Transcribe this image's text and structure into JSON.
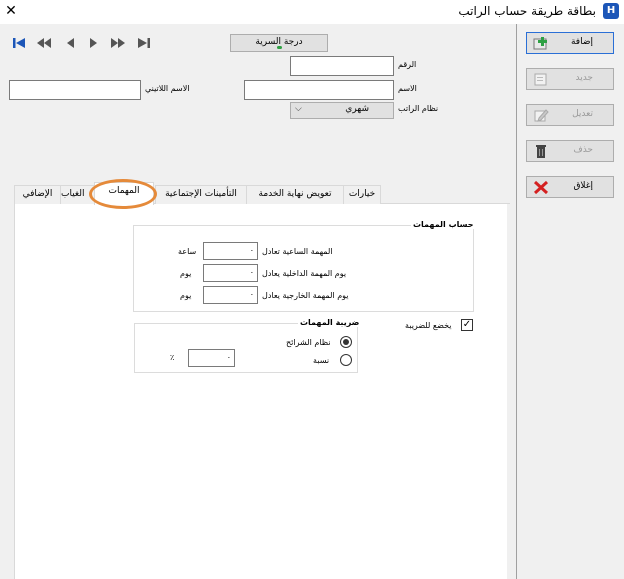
{
  "window": {
    "title": "بطاقة طريقة حساب الراتب",
    "icon_letter": "H",
    "close": "✕"
  },
  "header": {
    "secret_level_button": "درجة السرية",
    "labels": {
      "number": "الرقم",
      "name": "الاسم",
      "latin_name": "الاسم اللاتيني",
      "salary_system": "نظام الراتب"
    },
    "salary_system_value": "شهري"
  },
  "tabs": [
    {
      "label": "خيارات"
    },
    {
      "label": "تعويض نهاية الخدمة"
    },
    {
      "label": "التأمينات الإجتماعية"
    },
    {
      "label": "المهمات",
      "active": true
    },
    {
      "label": "الغياب"
    },
    {
      "label": "الإضافي"
    }
  ],
  "missions_group": {
    "title": "حساب المهمات",
    "rows": [
      {
        "label": "المهمة الساعية تعادل",
        "value": "٠",
        "unit": "ساعة"
      },
      {
        "label": "يوم المهمة الداخلية يعادل",
        "value": "٠",
        "unit": "يوم"
      },
      {
        "label": "يوم المهمة الخارجية يعادل",
        "value": "٠",
        "unit": "يوم"
      }
    ]
  },
  "tax": {
    "checkbox_label": "يخضع للضريبة",
    "checked": true,
    "group_title": "ضريبة المهمات",
    "options": [
      {
        "label": "نظام الشرائح",
        "selected": true
      },
      {
        "label": "نسبة",
        "selected": false
      }
    ],
    "percent_value": "٠",
    "percent_symbol": "٪"
  },
  "side_buttons": [
    {
      "label": "إضافة",
      "icon": "add-icon",
      "enabled": true
    },
    {
      "label": "جديد",
      "icon": "new-icon",
      "enabled": false
    },
    {
      "label": "تعديل",
      "icon": "edit-icon",
      "enabled": false
    },
    {
      "label": "حذف",
      "icon": "delete-icon",
      "enabled": false
    },
    {
      "label": "إغلاق",
      "icon": "close-icon",
      "enabled": true
    }
  ]
}
